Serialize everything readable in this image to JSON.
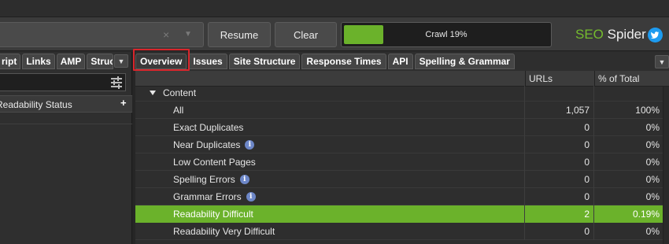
{
  "toolbar": {
    "url_clear_icon": "×",
    "url_dropdown_icon": "▼",
    "resume_label": "Resume",
    "clear_label": "Clear",
    "crawl_progress_label": "Crawl 19%",
    "crawl_progress": 0.19,
    "brand_seo": "SEO",
    "brand_rest": " Spider"
  },
  "left": {
    "tabs": [
      "ript",
      "Links",
      "AMP",
      "Struc"
    ],
    "dropdown_icon": "▼",
    "column_header": "Readability Status",
    "add_icon": "+"
  },
  "right": {
    "tabs": [
      "Overview",
      "Issues",
      "Site Structure",
      "Response Times",
      "API",
      "Spelling & Grammar"
    ],
    "active_tab": "Overview",
    "dropdown_icon": "▼",
    "columns": {
      "name": "",
      "urls": "URLs",
      "pct": "% of Total"
    },
    "section": "Content",
    "rows": [
      {
        "name": "All",
        "urls": "1,057",
        "pct": "100%",
        "info": false
      },
      {
        "name": "Exact Duplicates",
        "urls": "0",
        "pct": "0%",
        "info": false
      },
      {
        "name": "Near Duplicates",
        "urls": "0",
        "pct": "0%",
        "info": true
      },
      {
        "name": "Low Content Pages",
        "urls": "0",
        "pct": "0%",
        "info": false
      },
      {
        "name": "Spelling Errors",
        "urls": "0",
        "pct": "0%",
        "info": true
      },
      {
        "name": "Grammar Errors",
        "urls": "0",
        "pct": "0%",
        "info": true
      },
      {
        "name": "Readability Difficult",
        "urls": "2",
        "pct": "0.19%",
        "info": false,
        "selected": true
      },
      {
        "name": "Readability Very Difficult",
        "urls": "0",
        "pct": "0%",
        "info": false
      }
    ],
    "info_glyph": "i"
  },
  "colors": {
    "accent_green": "#6bb22b",
    "highlight_red": "#d9262c",
    "info_blue": "#6d87c8",
    "twitter_blue": "#1d9bf0"
  },
  "icons": {
    "url_clear": "close-icon",
    "filter": "filter-sliders-icon",
    "twitter": "twitter-icon",
    "info": "info-icon",
    "expand": "triangle-down-icon"
  }
}
